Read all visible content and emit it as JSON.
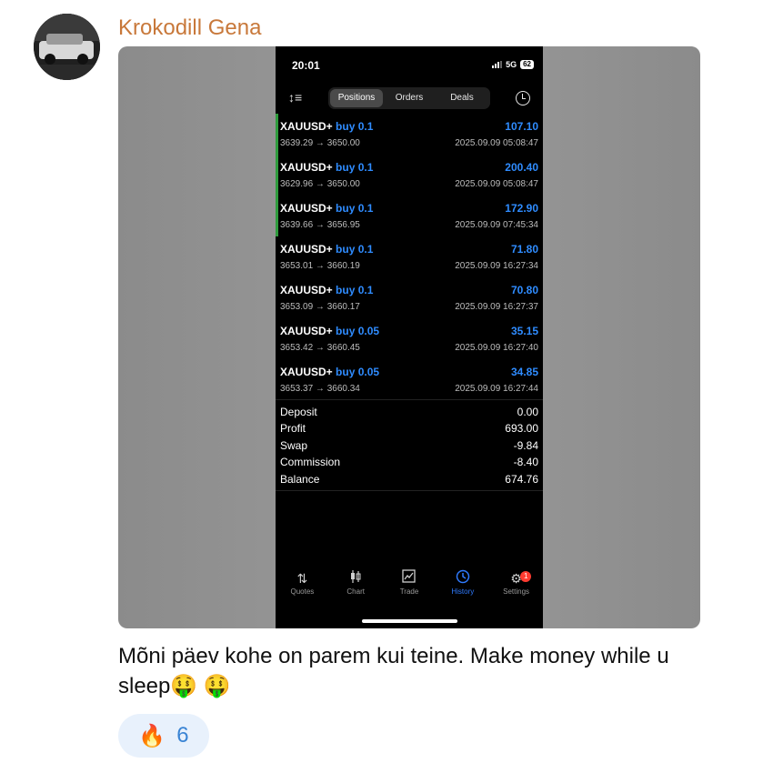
{
  "message": {
    "author": "Krokodill Gena",
    "text": "Mõni päev kohe on parem kui teine. Make money while u sleep🤑 🤑",
    "reaction": {
      "emoji": "🔥",
      "count": "6"
    }
  },
  "phone": {
    "status": {
      "time": "20:01",
      "network": "5G",
      "battery": "62"
    },
    "segments": [
      "Positions",
      "Orders",
      "Deals"
    ],
    "active_segment": "Positions",
    "deals": [
      {
        "symbol": "XAUUSD+",
        "side": "buy 0.1",
        "profit": "107.10",
        "prices": "3639.29 → 3650.00",
        "time": "2025.09.09 05:08:47",
        "marked": true
      },
      {
        "symbol": "XAUUSD+",
        "side": "buy 0.1",
        "profit": "200.40",
        "prices": "3629.96 → 3650.00",
        "time": "2025.09.09 05:08:47",
        "marked": true
      },
      {
        "symbol": "XAUUSD+",
        "side": "buy 0.1",
        "profit": "172.90",
        "prices": "3639.66 → 3656.95",
        "time": "2025.09.09 07:45:34",
        "marked": true
      },
      {
        "symbol": "XAUUSD+",
        "side": "buy 0.1",
        "profit": "71.80",
        "prices": "3653.01 → 3660.19",
        "time": "2025.09.09 16:27:34",
        "marked": false
      },
      {
        "symbol": "XAUUSD+",
        "side": "buy 0.1",
        "profit": "70.80",
        "prices": "3653.09 → 3660.17",
        "time": "2025.09.09 16:27:37",
        "marked": false
      },
      {
        "symbol": "XAUUSD+",
        "side": "buy 0.05",
        "profit": "35.15",
        "prices": "3653.42 → 3660.45",
        "time": "2025.09.09 16:27:40",
        "marked": false
      },
      {
        "symbol": "XAUUSD+",
        "side": "buy 0.05",
        "profit": "34.85",
        "prices": "3653.37 → 3660.34",
        "time": "2025.09.09 16:27:44",
        "marked": false
      }
    ],
    "summary": [
      {
        "label": "Deposit",
        "value": "0.00"
      },
      {
        "label": "Profit",
        "value": "693.00"
      },
      {
        "label": "Swap",
        "value": "-9.84"
      },
      {
        "label": "Commission",
        "value": "-8.40"
      },
      {
        "label": "Balance",
        "value": "674.76"
      }
    ],
    "tabs": [
      {
        "label": "Quotes",
        "icon": "quotes-icon"
      },
      {
        "label": "Chart",
        "icon": "chart-icon"
      },
      {
        "label": "Trade",
        "icon": "trade-icon"
      },
      {
        "label": "History",
        "icon": "history-icon"
      },
      {
        "label": "Settings",
        "icon": "settings-icon",
        "badge": "1"
      }
    ],
    "active_tab": "History",
    "colors": {
      "accent": "#2f8cff",
      "marker": "#2e9b3c",
      "badge": "#ff3b30"
    }
  }
}
